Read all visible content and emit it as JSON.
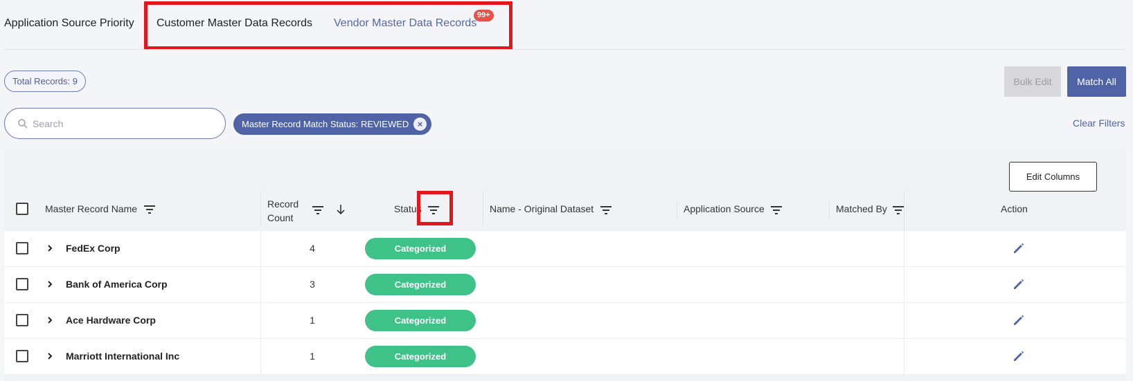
{
  "tabs": [
    {
      "label": "Application Source Priority"
    },
    {
      "label": "Customer Master Data Records"
    },
    {
      "label": "Vendor Master Data Records",
      "badge": "99+"
    }
  ],
  "summary": {
    "total_records": "Total Records: 9"
  },
  "actions": {
    "bulk_edit": "Bulk Edit",
    "match_all": "Match All",
    "edit_columns": "Edit Columns",
    "clear_filters": "Clear Filters"
  },
  "search": {
    "placeholder": "Search",
    "value": ""
  },
  "filters": [
    {
      "label": "Master Record Match Status: REVIEWED"
    }
  ],
  "table": {
    "columns": [
      {
        "label": "Master Record Name"
      },
      {
        "label": "Record\nCount"
      },
      {
        "label": "Status"
      },
      {
        "label": "Name - Original Dataset"
      },
      {
        "label": "Application Source"
      },
      {
        "label": "Matched By"
      },
      {
        "label": "Action"
      }
    ],
    "rows": [
      {
        "name": "FedEx Corp",
        "count": "4",
        "status": "Categorized"
      },
      {
        "name": "Bank of America Corp",
        "count": "3",
        "status": "Categorized"
      },
      {
        "name": "Ace Hardware Corp",
        "count": "1",
        "status": "Categorized"
      },
      {
        "name": "Marriott International Inc",
        "count": "1",
        "status": "Categorized"
      }
    ]
  },
  "colors": {
    "accent": "#4f63a6",
    "status_green": "#3ec288",
    "highlight": "#e4161b",
    "badge": "#e5534b"
  },
  "icons": [
    "search-icon",
    "filter-icon",
    "sort-down-icon",
    "chevron-right-icon",
    "edit-pencil-icon",
    "close-circle-icon"
  ]
}
